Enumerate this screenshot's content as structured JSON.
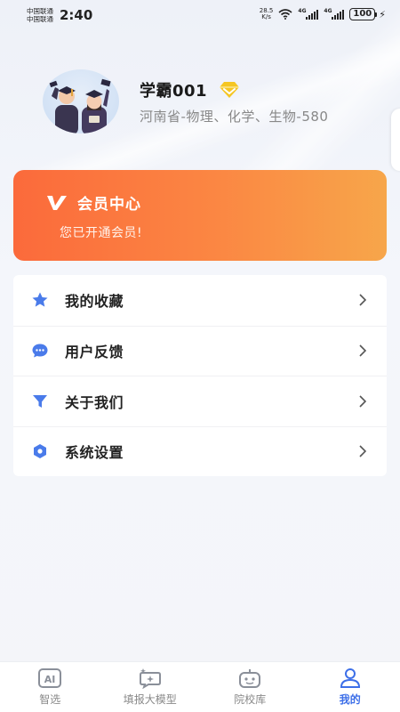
{
  "status_bar": {
    "carrier_1": "中国联通",
    "carrier_2": "中国联通",
    "time": "2:40",
    "net_speed_value": "28.5",
    "net_speed_unit": "K/s",
    "signal_tag_1": "4G",
    "signal_tag_2": "4G",
    "battery": "100"
  },
  "profile": {
    "username": "学霸001",
    "subjects": "河南省-物理、化学、生物-580",
    "avatar_icon": "graduates-avatar",
    "vip_icon": "diamond-vip-icon"
  },
  "member_card": {
    "title": "会员中心",
    "subtitle": "您已开通会员!",
    "icon": "v-logo-icon",
    "colors": {
      "start": "#fb6a3b",
      "end": "#f7a64a"
    }
  },
  "menu": {
    "items": [
      {
        "label": "我的收藏",
        "icon": "star-icon"
      },
      {
        "label": "用户反馈",
        "icon": "chat-bubble-icon"
      },
      {
        "label": "关于我们",
        "icon": "funnel-icon"
      },
      {
        "label": "系统设置",
        "icon": "hexagon-settings-icon"
      }
    ],
    "icon_color": "#4a7bea"
  },
  "tabbar": {
    "tabs": [
      {
        "label": "智选",
        "icon": "ai-icon",
        "active": false
      },
      {
        "label": "填报大模型",
        "icon": "sparkle-chat-icon",
        "active": false
      },
      {
        "label": "院校库",
        "icon": "robot-icon",
        "active": false
      },
      {
        "label": "我的",
        "icon": "person-icon",
        "active": true
      }
    ],
    "active_color": "#3d6fe8"
  }
}
